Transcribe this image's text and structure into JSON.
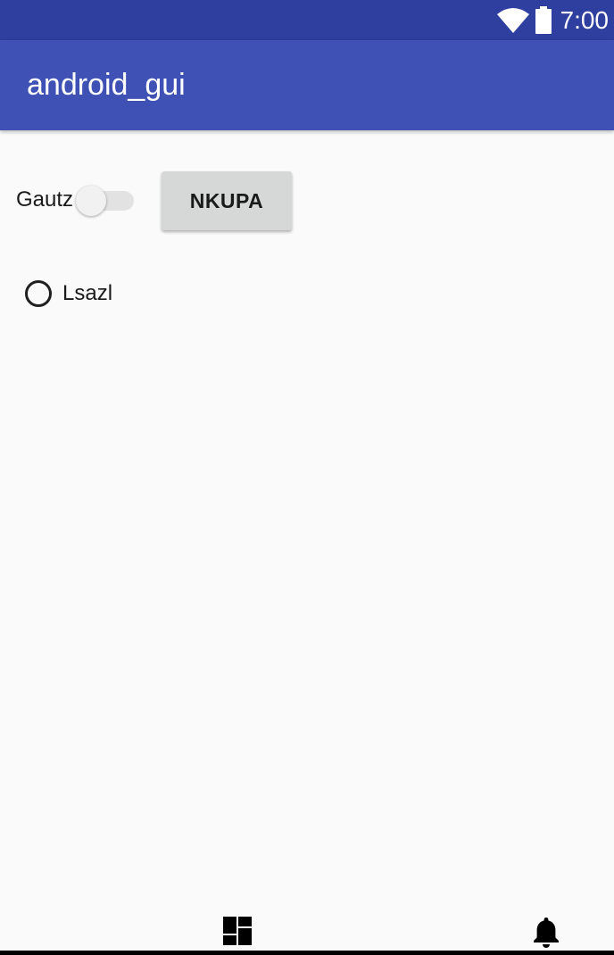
{
  "status_bar": {
    "time": "7:00",
    "icons": [
      "wifi-icon",
      "battery-icon"
    ],
    "background_color": "#2f3f9f"
  },
  "app_bar": {
    "title": "android_gui",
    "background_color": "#3f51b5"
  },
  "content": {
    "switch": {
      "label": "Gautz",
      "checked": false
    },
    "button": {
      "label": "NKUPA"
    },
    "radio": {
      "label": "Lsazl",
      "selected": false
    }
  },
  "bottom_nav": {
    "icons": [
      "dashboard-icon",
      "notifications-bell-icon"
    ]
  }
}
